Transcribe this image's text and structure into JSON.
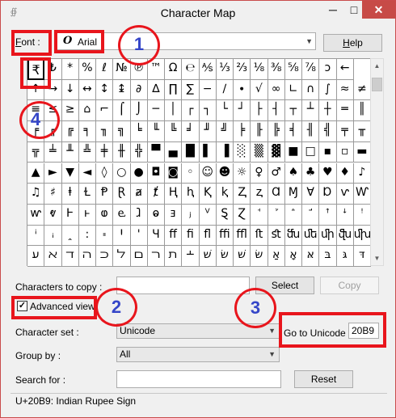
{
  "window": {
    "title": "Character Map",
    "app_icon": "character-map-icon",
    "minimize_glyph": "─",
    "maximize_glyph": "□",
    "close_glyph": "✕"
  },
  "font": {
    "label": "Font :",
    "icon_glyph": "O",
    "value": "Arial",
    "help_label": "Help"
  },
  "grid": {
    "rows": [
      [
        "₹",
        "₺",
        "*",
        "%",
        "ℓ",
        "№",
        "℗",
        "™",
        "Ω",
        "℮",
        "⅍",
        "⅓",
        "⅔",
        "⅛",
        "⅜",
        "⅝",
        "⅞",
        "ↄ",
        "←"
      ],
      [
        "↑",
        "→",
        "↓",
        "↔",
        "↕",
        "↨",
        "∂",
        "∆",
        "∏",
        "∑",
        "−",
        "∕",
        "∙",
        "√",
        "∞",
        "∟",
        "∩",
        "∫",
        "≈",
        "≠"
      ],
      [
        "≡",
        "≤",
        "≥",
        "⌂",
        "⌐",
        "⌠",
        "⌡",
        "─",
        "│",
        "┌",
        "┐",
        "└",
        "┘",
        "├",
        "┤",
        "┬",
        "┴",
        "┼",
        "═",
        "║"
      ],
      [
        "╒",
        "╓",
        "╔",
        "╕",
        "╖",
        "╗",
        "╘",
        "╙",
        "╚",
        "╛",
        "╜",
        "╝",
        "╞",
        "╟",
        "╠",
        "╡",
        "╢",
        "╣",
        "╤",
        "╥"
      ],
      [
        "╦",
        "╧",
        "╨",
        "╩",
        "╪",
        "╫",
        "╬",
        "▀",
        "▄",
        "█",
        "▌",
        "▐",
        "░",
        "▒",
        "▓",
        "■",
        "□",
        "▪",
        "▫",
        "▬"
      ],
      [
        "▲",
        "►",
        "▼",
        "◄",
        "◊",
        "○",
        "●",
        "◘",
        "◙",
        "◦",
        "☺",
        "☻",
        "☼",
        "♀",
        "♂",
        "♠",
        "♣",
        "♥",
        "♦",
        "♪"
      ],
      [
        "♫",
        "♯",
        "ⱡ",
        "Ɫ",
        "Ᵽ",
        "Ɽ",
        "ⱥ",
        "ⱦ",
        "Ⱨ",
        "ⱨ",
        "Ⱪ",
        "ⱪ",
        "Ⱬ",
        "ⱬ",
        "Ɑ",
        "Ɱ",
        "Ɐ",
        "Ɒ",
        "ⱱ",
        "Ⱳ"
      ],
      [
        "ⱳ",
        "ⱴ",
        "Ⱶ",
        "ⱶ",
        "ⱷ",
        "ⱸ",
        "ⱹ",
        "ⱺ",
        "ⱻ",
        "ⱼ",
        "ⱽ",
        "Ȿ",
        "Ɀ",
        "ꜗ",
        "ꜘ",
        "ꜙ",
        "ꜚ",
        "ꜛ",
        "ꜜ",
        "ꜝ"
      ],
      [
        "ꜞ",
        "ꜟ",
        "ꞈ",
        "꞉",
        "꞊",
        "Ꞌ",
        "ꞌ",
        "Ɥ",
        "ﬀ",
        "ﬁ",
        "ﬂ",
        "ﬃ",
        "ﬄ",
        "ﬅ",
        "ﬆ",
        "ﬓ",
        "ﬔ",
        "ﬕ",
        "ﬖ",
        "ﬗ"
      ],
      [
        "ﬠ",
        "ﬡ",
        "ﬢ",
        "ﬣ",
        "ﬤ",
        "ﬥ",
        "ﬦ",
        "ﬧ",
        "ﬨ",
        "﬩",
        "שׁ",
        "שׂ",
        "שּׁ",
        "שּׂ",
        "אַ",
        "אָ",
        "אּ",
        "בּ",
        "גּ",
        "דּ"
      ]
    ],
    "selected": "₹"
  },
  "copy": {
    "label": "Characters to copy :",
    "value": "",
    "select_label": "Select",
    "copy_label": "Copy"
  },
  "advanced": {
    "label": "Advanced view",
    "checked_glyph": "✓"
  },
  "charset": {
    "label": "Character set :",
    "value": "Unicode"
  },
  "goto": {
    "label": "Go to Unicode :",
    "value": "20B9"
  },
  "groupby": {
    "label": "Group by :",
    "value": "All"
  },
  "search": {
    "label": "Search for :",
    "value": "",
    "reset_label": "Reset"
  },
  "status": {
    "text": "U+20B9: Indian Rupee Sign"
  },
  "annotations": [
    "1",
    "2",
    "3",
    "4"
  ],
  "colors": {
    "annotation_red": "#e8151c",
    "annotation_blue": "#3546c8",
    "close_button": "#c74b47"
  }
}
